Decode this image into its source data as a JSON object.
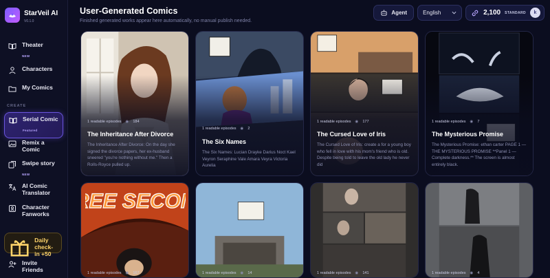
{
  "app": {
    "name": "StarVeil AI",
    "version": "V0.1.0"
  },
  "sidebar": {
    "items": [
      {
        "label": "Theater",
        "badge": "NEW"
      },
      {
        "label": "Characters"
      },
      {
        "label": "My Comics"
      }
    ],
    "section_create": "CREATE",
    "create_items": [
      {
        "label": "Serial Comic",
        "badge": "Featured"
      },
      {
        "label": "Remix a Comic"
      },
      {
        "label": "Swipe story",
        "badge": "NEW"
      },
      {
        "label": "AI Comic Translator"
      },
      {
        "label": "Character Fanworks"
      }
    ],
    "checkin": "Daily check-in +50",
    "invite": "Invite Friends"
  },
  "header": {
    "title": "User-Generated Comics",
    "subtitle": "Finished generated works appear here automatically, no manual publish needed."
  },
  "topbar": {
    "agent_label": "Agent",
    "language": "English",
    "credits": "2,100",
    "tier": "STANDARD",
    "avatar_initial": "k"
  },
  "comics": [
    {
      "episodes": "1 readable episodes",
      "views": "184",
      "title": "The Inheritance After Divorce",
      "desc": "The Inheritance After Divorce: On the day she signed the divorce papers, her ex-husband sneered \"you're nothing without me.\" Then a Rolls-Royce pulled up."
    },
    {
      "episodes": "1 readable episodes",
      "views": "2",
      "title": "The Six Names",
      "desc": "The Six Names: Lucian Drayke Darius Noct Kael Veyron Seraphine Vale Amara Veyra Victoria Aurelia"
    },
    {
      "episodes": "1 readable episodes",
      "views": "177",
      "title": "The Cursed Love of Iris",
      "desc": "The Cursed Love of Iris: create a for a young boy who fell in love with his mom's friend who is old. Despite being told to leave the old lady he never did"
    },
    {
      "episodes": "1 readable episodes",
      "views": "7",
      "title": "The Mysterious Promise",
      "desc": "The Mysterious Promise: ethan carter PAGE 1 — THE MYSTERIOUS PROMISE **Panel 1 — Complete darkness.** The screen is almost entirely black."
    },
    {
      "episodes": "1 readable episodes",
      "views": "167",
      "art_text": "THREE SECONDS"
    },
    {
      "episodes": "1 readable episodes",
      "views": "14"
    },
    {
      "episodes": "1 readable episodes",
      "views": "141"
    },
    {
      "episodes": "1 readable episodes",
      "views": "4"
    }
  ],
  "colors": {
    "accent": "#7a5cff",
    "background": "#0b0d1f",
    "gold": "#ffd46a"
  }
}
